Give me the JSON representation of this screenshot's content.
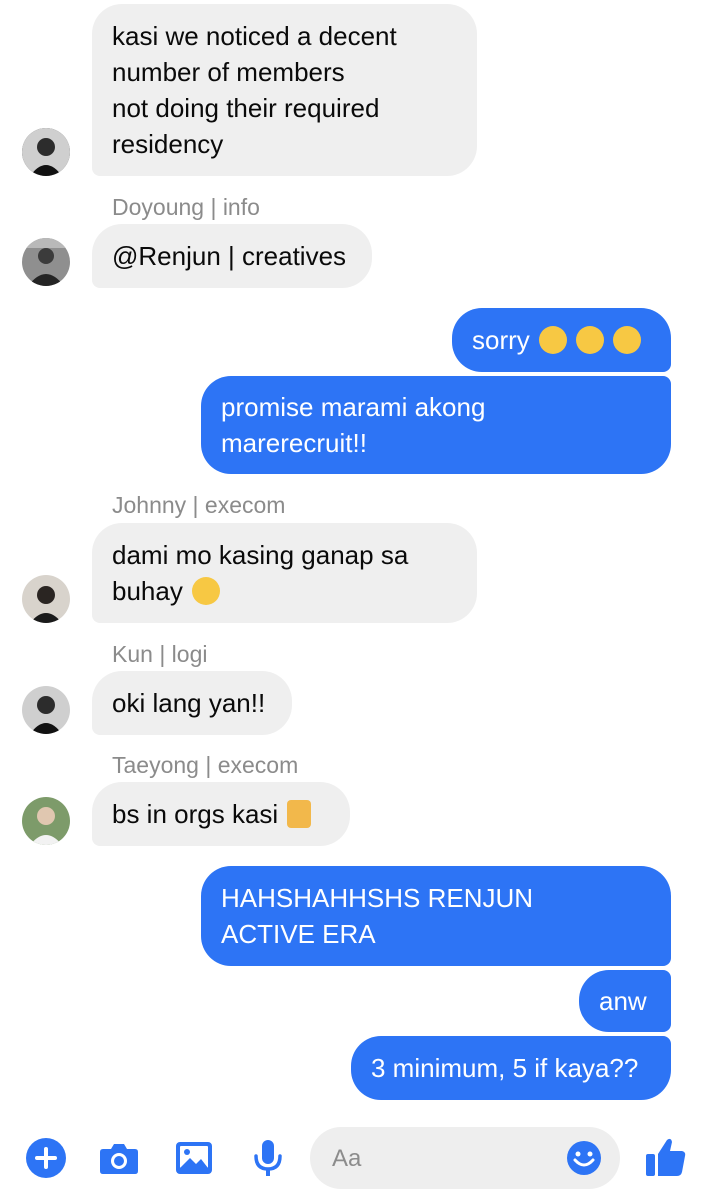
{
  "colors": {
    "accent": "#2d74f5",
    "incoming_bubble": "#efefef",
    "sender_label": "#8b8b8b"
  },
  "messages": [
    {
      "lines": [
        "kasi we noticed a decent",
        "number of members",
        "not doing their required",
        "residency"
      ]
    },
    {
      "sender": "Doyoung | info",
      "lines": [
        "@Renjun | creatives"
      ]
    },
    {
      "lines": [
        "sorry "
      ],
      "emoji_count": 3,
      "emoji": "pensive-face"
    },
    {
      "lines": [
        "promise marami akong",
        "marerecruit!!"
      ]
    },
    {
      "sender": "Johnny | execom",
      "lines": [
        "dami mo kasing ganap sa",
        "buhay "
      ],
      "emoji": "tears-of-joy-face"
    },
    {
      "sender": "Kun | logi",
      "lines": [
        "oki lang yan!!"
      ]
    },
    {
      "sender": "Taeyong | execom",
      "lines": [
        "bs in orgs kasi "
      ],
      "emoji": "person-cartwheeling"
    },
    {
      "lines": [
        "HAHSHAHHSHS RENJUN",
        "ACTIVE ERA"
      ]
    },
    {
      "lines": [
        "anw"
      ]
    },
    {
      "lines": [
        "3 minimum, 5 if kaya??"
      ]
    }
  ],
  "composer": {
    "placeholder": "Aa",
    "icons": [
      "plus-icon",
      "camera-icon",
      "image-icon",
      "microphone-icon",
      "smiley-icon",
      "thumbs-up-icon"
    ]
  }
}
